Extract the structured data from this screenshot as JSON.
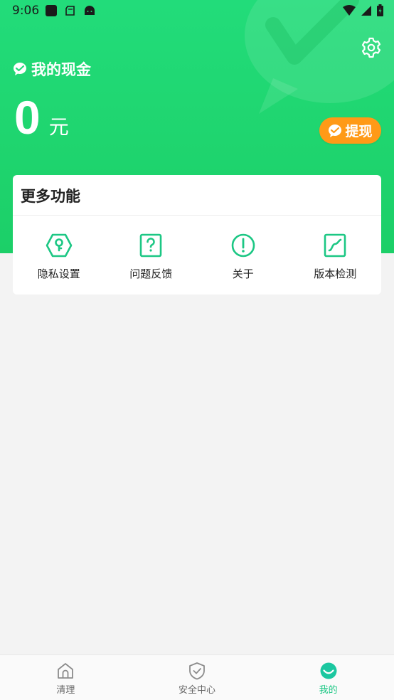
{
  "status_bar": {
    "time": "9:06"
  },
  "header": {
    "title": "我的现金",
    "amount": "0",
    "unit": "元",
    "withdraw_label": "提现"
  },
  "more_functions": {
    "title": "更多功能",
    "items": [
      {
        "label": "隐私设置",
        "icon": "privacy-key-icon"
      },
      {
        "label": "问题反馈",
        "icon": "question-icon"
      },
      {
        "label": "关于",
        "icon": "info-exclamation-icon"
      },
      {
        "label": "版本检测",
        "icon": "version-chart-icon"
      }
    ]
  },
  "tabbar": {
    "items": [
      {
        "label": "清理",
        "icon": "home-icon",
        "active": false
      },
      {
        "label": "安全中心",
        "icon": "shield-icon",
        "active": false
      },
      {
        "label": "我的",
        "icon": "smile-icon",
        "active": true
      }
    ]
  },
  "colors": {
    "brand_green": "#1fd56f",
    "icon_green": "#1cc784",
    "withdraw_orange": "#ff9a17",
    "active_tab": "#1cc784"
  }
}
